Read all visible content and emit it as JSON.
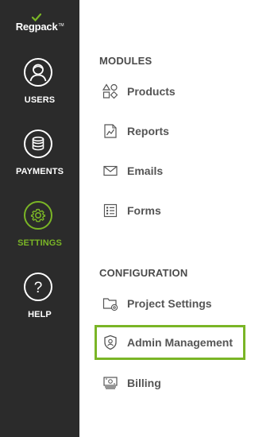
{
  "brand": {
    "name": "Regpack",
    "accent": "#7ab526",
    "rail_bg": "#2b2b2b"
  },
  "rail": {
    "items": [
      {
        "label": "USERS",
        "icon": "user-icon",
        "active": false
      },
      {
        "label": "PAYMENTS",
        "icon": "coins-icon",
        "active": false
      },
      {
        "label": "SETTINGS",
        "icon": "gear-icon",
        "active": true
      },
      {
        "label": "HELP",
        "icon": "question-icon",
        "active": false
      }
    ]
  },
  "menu": {
    "modules_heading": "MODULES",
    "modules": [
      {
        "label": "Products",
        "icon": "shapes-icon"
      },
      {
        "label": "Reports",
        "icon": "report-icon"
      },
      {
        "label": "Emails",
        "icon": "envelope-icon"
      },
      {
        "label": "Forms",
        "icon": "form-icon"
      }
    ],
    "configuration_heading": "CONFIGURATION",
    "configuration": [
      {
        "label": "Project Settings",
        "icon": "folder-settings-icon"
      },
      {
        "label": "Admin Management",
        "icon": "admin-shield-icon",
        "highlighted": true
      },
      {
        "label": "Billing",
        "icon": "billing-icon"
      }
    ]
  }
}
